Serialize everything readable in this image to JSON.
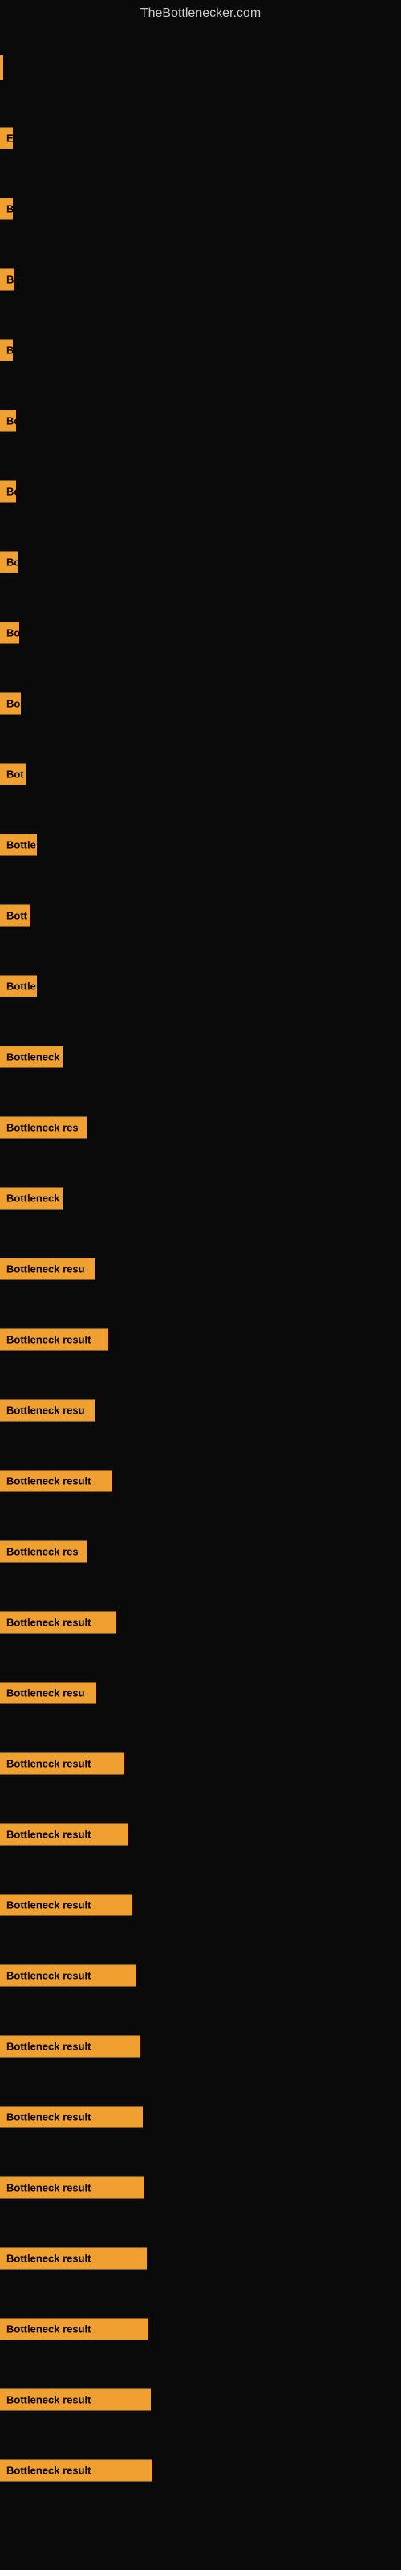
{
  "site_title": "TheBottlenecker.com",
  "items": [
    {
      "label": "",
      "width": 4,
      "truncated": ""
    },
    {
      "label": "E",
      "width": 8,
      "truncated": "E"
    },
    {
      "label": "B",
      "width": 12,
      "truncated": "B"
    },
    {
      "label": "Bo",
      "width": 18,
      "truncated": "Bo"
    },
    {
      "label": "B",
      "width": 12,
      "truncated": "B"
    },
    {
      "label": "Bo",
      "width": 20,
      "truncated": "Bo"
    },
    {
      "label": "Bo",
      "width": 20,
      "truncated": "Bo"
    },
    {
      "label": "Bo",
      "width": 22,
      "truncated": "Bo"
    },
    {
      "label": "Bo",
      "width": 24,
      "truncated": "Bo"
    },
    {
      "label": "Bo",
      "width": 26,
      "truncated": "Bo"
    },
    {
      "label": "Bot",
      "width": 32,
      "truncated": "Bot"
    },
    {
      "label": "Bottle",
      "width": 46,
      "truncated": "Bottle"
    },
    {
      "label": "Bott",
      "width": 38,
      "truncated": "Bott"
    },
    {
      "label": "Bottle",
      "width": 46,
      "truncated": "Bottle"
    },
    {
      "label": "Bottleneck",
      "width": 78,
      "truncated": "Bottleneck"
    },
    {
      "label": "Bottleneck res",
      "width": 108,
      "truncated": "Bottleneck res"
    },
    {
      "label": "Bottleneck",
      "width": 78,
      "truncated": "Bottleneck"
    },
    {
      "label": "Bottleneck resu",
      "width": 118,
      "truncated": "Bottleneck resu"
    },
    {
      "label": "Bottleneck result",
      "width": 135,
      "truncated": "Bottleneck result"
    },
    {
      "label": "Bottleneck resu",
      "width": 118,
      "truncated": "Bottleneck resu"
    },
    {
      "label": "Bottleneck result",
      "width": 140,
      "truncated": "Bottleneck result"
    },
    {
      "label": "Bottleneck res",
      "width": 108,
      "truncated": "Bottleneck res"
    },
    {
      "label": "Bottleneck result",
      "width": 145,
      "truncated": "Bottleneck result"
    },
    {
      "label": "Bottleneck resu",
      "width": 120,
      "truncated": "Bottleneck resu"
    },
    {
      "label": "Bottleneck result",
      "width": 155,
      "truncated": "Bottleneck result"
    },
    {
      "label": "Bottleneck result",
      "width": 160,
      "truncated": "Bottleneck result"
    },
    {
      "label": "Bottleneck result",
      "width": 165,
      "truncated": "Bottleneck result"
    },
    {
      "label": "Bottleneck result",
      "width": 170,
      "truncated": "Bottleneck result"
    },
    {
      "label": "Bottleneck result",
      "width": 175,
      "truncated": "Bottleneck result"
    },
    {
      "label": "Bottleneck result",
      "width": 178,
      "truncated": "Bottleneck result"
    },
    {
      "label": "Bottleneck result",
      "width": 180,
      "truncated": "Bottleneck result"
    },
    {
      "label": "Bottleneck result",
      "width": 183,
      "truncated": "Bottleneck result"
    },
    {
      "label": "Bottleneck result",
      "width": 185,
      "truncated": "Bottleneck result"
    },
    {
      "label": "Bottleneck result",
      "width": 188,
      "truncated": "Bottleneck result"
    },
    {
      "label": "Bottleneck result",
      "width": 190,
      "truncated": "Bottleneck result"
    }
  ]
}
